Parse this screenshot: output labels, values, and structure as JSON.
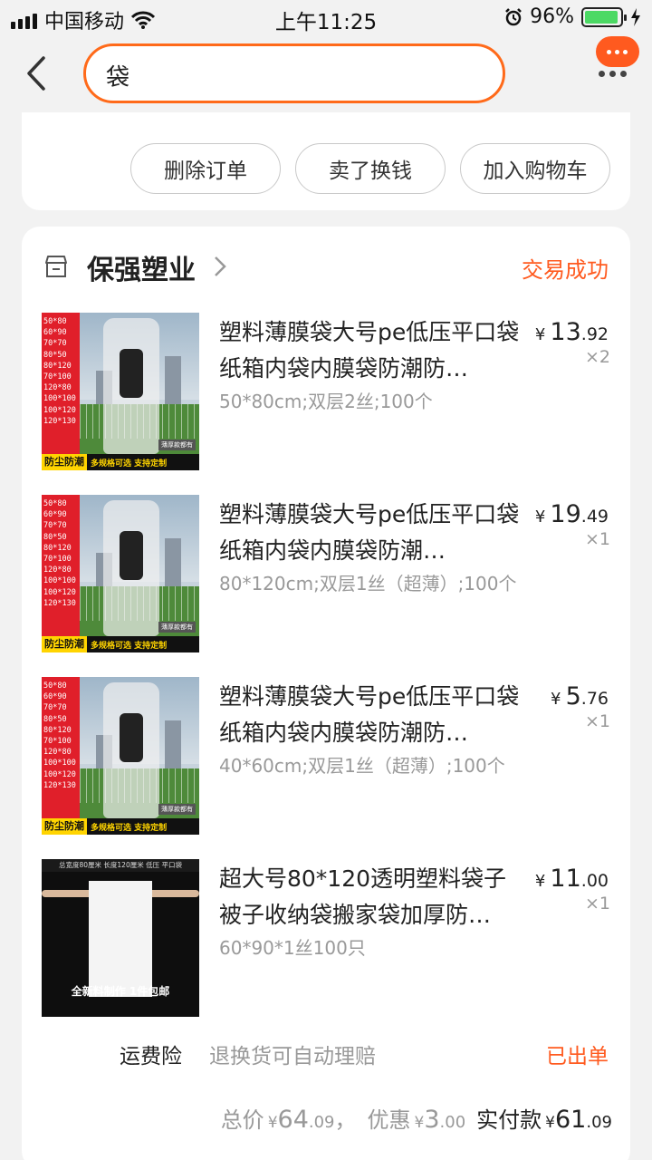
{
  "status_bar": {
    "carrier": "中国移动",
    "time": "上午11:25",
    "battery": "96%",
    "battery_level": 0.96
  },
  "search": {
    "query": "袋"
  },
  "actions": {
    "delete": "删除订单",
    "sell": "卖了换钱",
    "add_cart": "加入购物车"
  },
  "shop": {
    "name": "保强塑业",
    "status": "交易成功"
  },
  "thumb": {
    "sizes": [
      "50*80",
      "60*90",
      "70*70",
      "80*50",
      "80*120",
      "70*100",
      "120*80",
      "100*100",
      "100*120",
      "120*130"
    ],
    "badge_left": "防尘防潮",
    "badge_right": "多规格可选 支持定制",
    "tag": "薄厚款都有",
    "dark_top": "总宽度80厘米 长度120厘米 低压 平口袋",
    "dark_caption": "全新料制作 1件包邮"
  },
  "items": [
    {
      "title": "塑料薄膜袋大号pe低压平口袋纸箱内袋内膜袋防潮防…",
      "spec": "50*80cm;双层2丝;100个",
      "currency": "¥",
      "price_int": "13",
      "price_dec": ".92",
      "qty": "×2"
    },
    {
      "title": "塑料薄膜袋大号pe低压平口袋纸箱内袋内膜袋防潮…",
      "spec": "80*120cm;双层1丝（超薄）;100个",
      "currency": "¥",
      "price_int": "19",
      "price_dec": ".49",
      "qty": "×1"
    },
    {
      "title": "塑料薄膜袋大号pe低压平口袋纸箱内袋内膜袋防潮防…",
      "spec": "40*60cm;双层1丝（超薄）;100个",
      "currency": "¥",
      "price_int": "5",
      "price_dec": ".76",
      "qty": "×1"
    },
    {
      "title": "超大号80*120透明塑料袋子被子收纳袋搬家袋加厚防…",
      "spec": "60*90*1丝100只",
      "currency": "¥",
      "price_int": "11",
      "price_dec": ".00",
      "qty": "×1"
    }
  ],
  "insurance": {
    "label": "运费险",
    "desc": "退换货可自动理赔",
    "status": "已出单"
  },
  "totals": {
    "total_label": "总价",
    "total_int": "64",
    "total_dec": ".09",
    "sep": "，",
    "discount_label": "优惠",
    "discount_int": "3",
    "discount_dec": ".00",
    "paid_label": "实付款",
    "paid_int": "61",
    "paid_dec": ".09",
    "currency": "¥"
  },
  "colors": {
    "accent": "#ff5a1f",
    "search_border": "#ff6a1a"
  }
}
